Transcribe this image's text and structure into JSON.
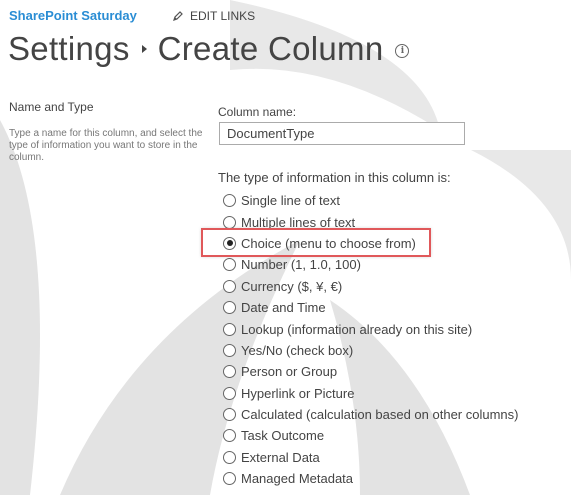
{
  "header": {
    "site_title": "SharePoint Saturday",
    "edit_links_label": "EDIT LINKS"
  },
  "breadcrumb": {
    "parent": "Settings",
    "current": "Create Column"
  },
  "section": {
    "heading": "Name and Type",
    "description": "Type a name for this column, and select the type of information you want to store in the column."
  },
  "form": {
    "column_name_label": "Column name:",
    "column_name_value": "DocumentType",
    "type_label": "The type of information in this column is:",
    "selected_type": "Choice (menu to choose from)",
    "types": [
      "Single line of text",
      "Multiple lines of text",
      "Choice (menu to choose from)",
      "Number (1, 1.0, 100)",
      "Currency ($, ¥, €)",
      "Date and Time",
      "Lookup (information already on this site)",
      "Yes/No (check box)",
      "Person or Group",
      "Hyperlink or Picture",
      "Calculated (calculation based on other columns)",
      "Task Outcome",
      "External Data",
      "Managed Metadata"
    ]
  },
  "icons": {
    "edit": "pencil-icon",
    "info": "info-icon",
    "breadcrumb_separator": "triangle-right-icon"
  },
  "colors": {
    "site_title": "#2a8dd4",
    "text": "#444444",
    "highlight": "#e0585a",
    "watermark": "#d9d9d9"
  }
}
